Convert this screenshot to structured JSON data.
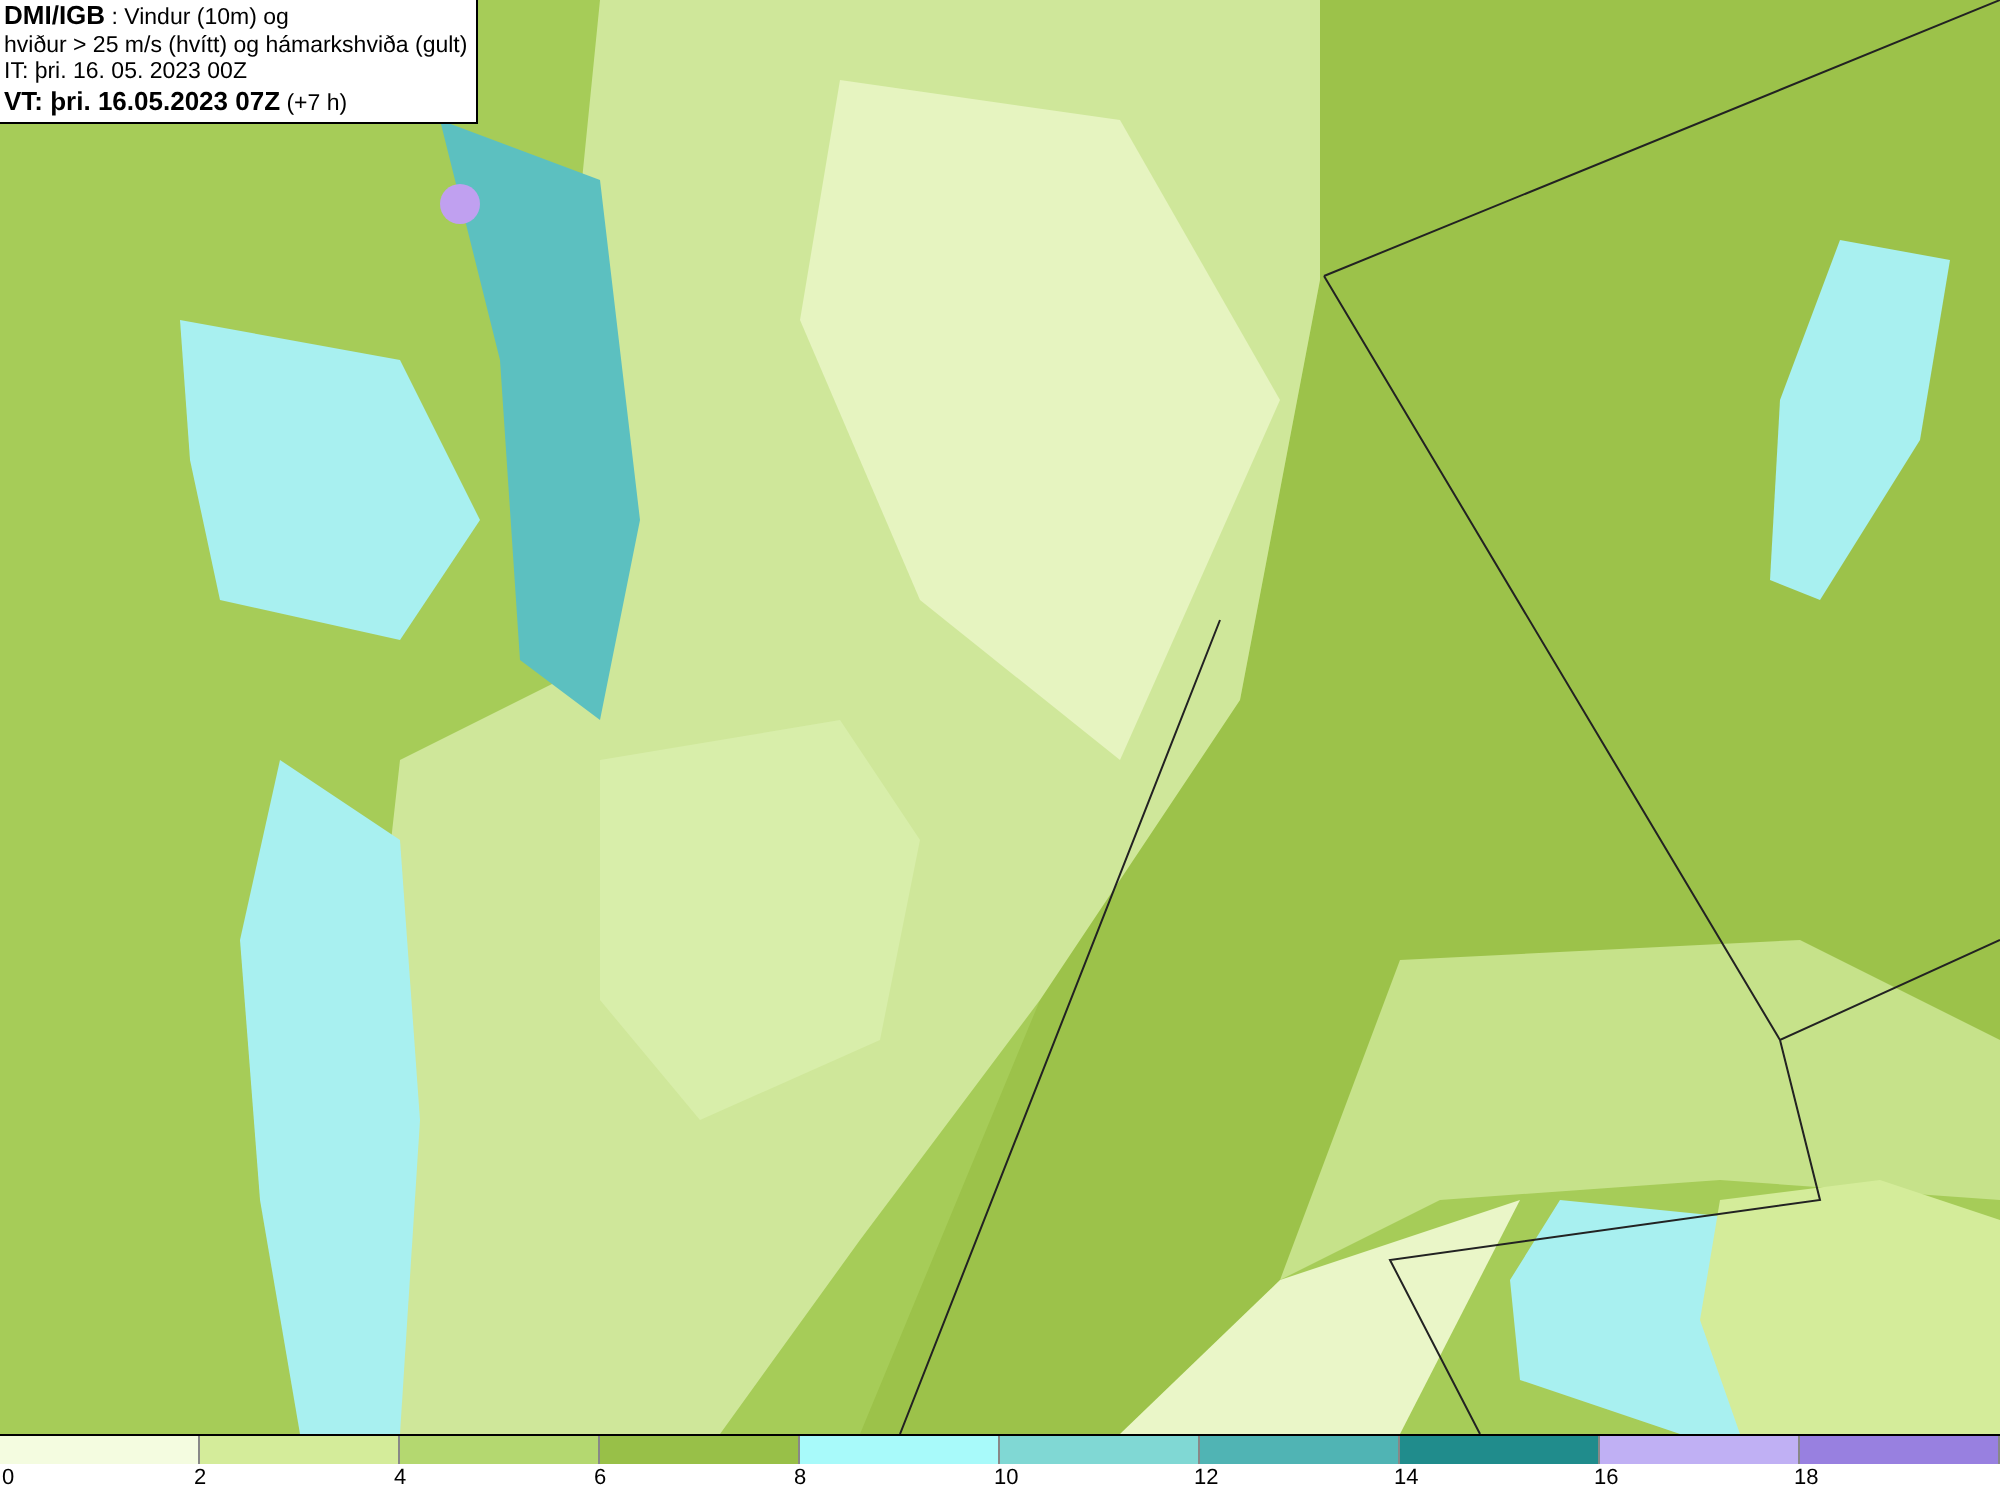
{
  "title_box": {
    "lines": [
      "**DMI/IGB** : Vindur (10m) og",
      "hviður > 25 m/s (hvítt) og hámarkshviða (gult)",
      "IT: þri. 16. 05. 2023 00Z",
      "**VT: þri. 16.05.2023 07Z** (+7 h)"
    ]
  },
  "legend": {
    "bins": [
      {
        "label": "0",
        "color": "#f4fce0"
      },
      {
        "label": "2",
        "color": "#d4ec9a"
      },
      {
        "label": "4",
        "color": "#b4d870"
      },
      {
        "label": "6",
        "color": "#98c048"
      },
      {
        "label": "8",
        "color": "#a8fafa"
      },
      {
        "label": "10",
        "color": "#80d8d4"
      },
      {
        "label": "12",
        "color": "#50b4b4"
      },
      {
        "label": "14",
        "color": "#208c8c"
      },
      {
        "label": "16",
        "color": "#c0b0f4"
      },
      {
        "label": "18",
        "color": "#9880e0"
      }
    ]
  }
}
